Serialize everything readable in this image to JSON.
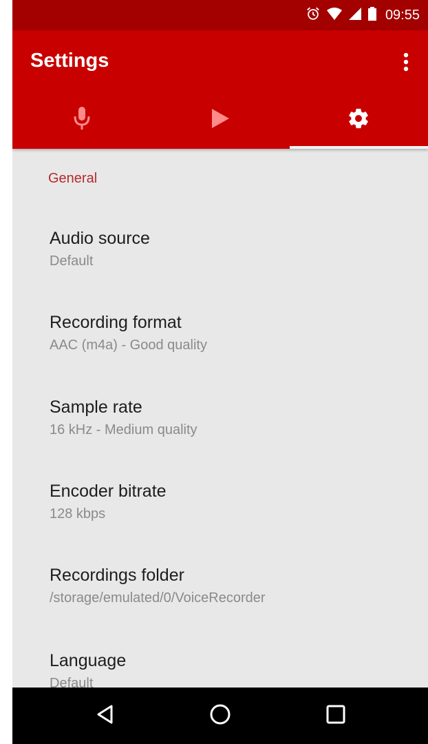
{
  "status_bar": {
    "time": "09:55",
    "icons": [
      "alarm-icon",
      "wifi-icon",
      "signal-icon",
      "battery-icon"
    ]
  },
  "toolbar": {
    "title": "Settings",
    "overflow_icon": "more-vert-icon"
  },
  "tabs": [
    {
      "icon": "microphone-icon",
      "selected": false
    },
    {
      "icon": "play-icon",
      "selected": false
    },
    {
      "icon": "gear-icon",
      "selected": true
    }
  ],
  "settings": {
    "section_header": "General",
    "items": [
      {
        "title": "Audio source",
        "summary": "Default"
      },
      {
        "title": "Recording format",
        "summary": "AAC (m4a) - Good quality"
      },
      {
        "title": "Sample rate",
        "summary": "16 kHz - Medium quality"
      },
      {
        "title": "Encoder bitrate",
        "summary": "128 kbps"
      },
      {
        "title": "Recordings folder",
        "summary": "/storage/emulated/0/VoiceRecorder"
      },
      {
        "title": "Language",
        "summary": "Default"
      }
    ]
  },
  "nav_bar": {
    "buttons": [
      "back-icon",
      "home-icon",
      "recents-icon"
    ]
  },
  "colors": {
    "status_bar": "#a30000",
    "toolbar": "#c80000",
    "accent": "#b52a2a",
    "background": "#e8e8e8"
  }
}
